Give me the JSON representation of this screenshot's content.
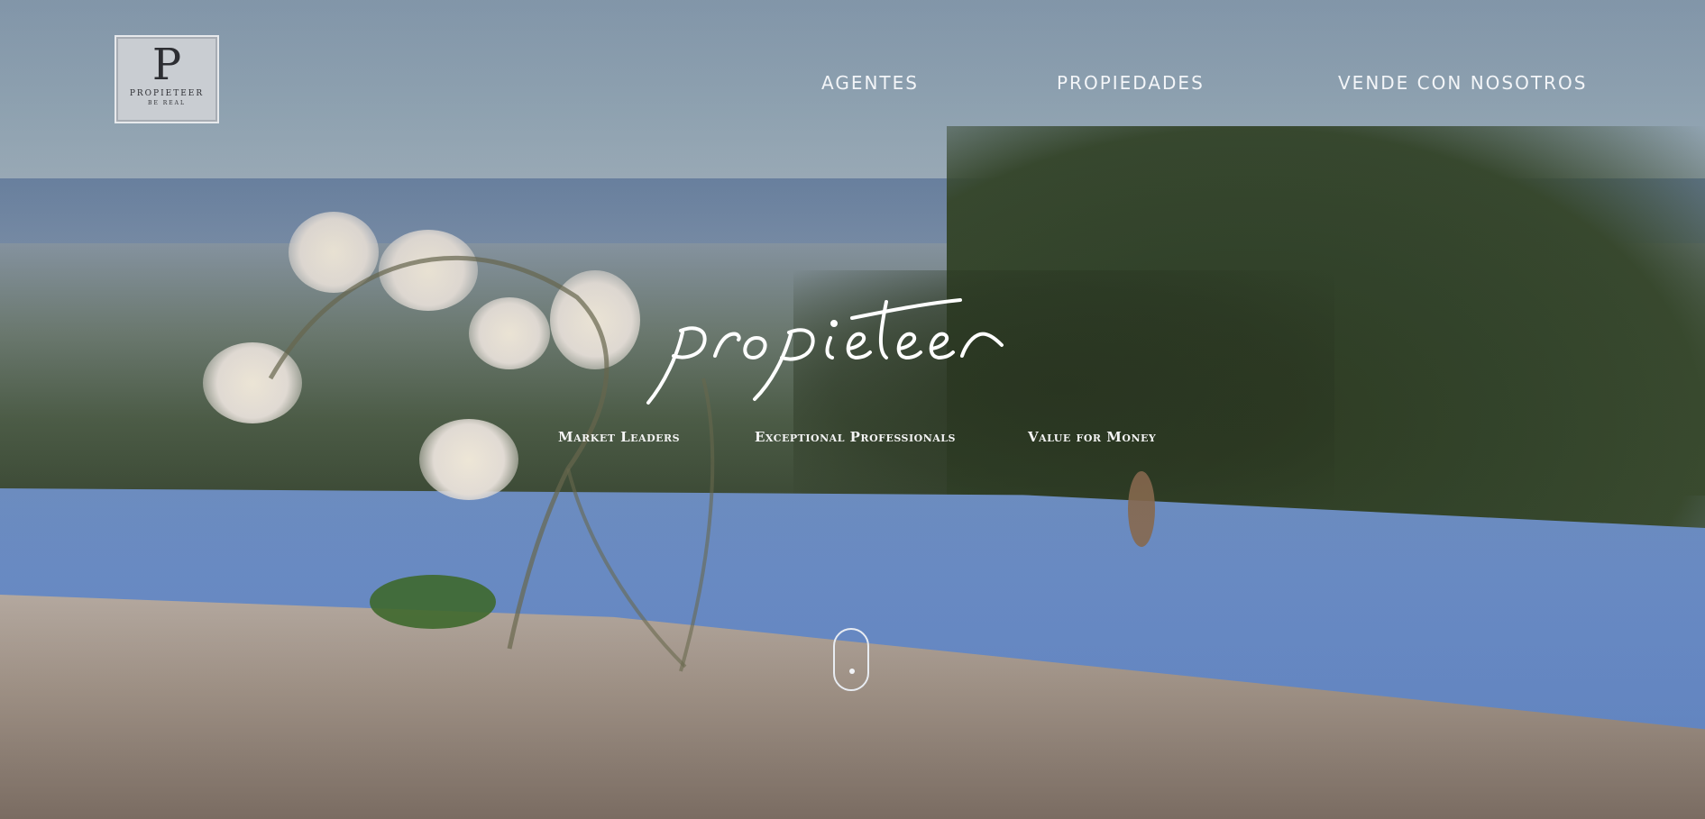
{
  "header": {
    "logo": {
      "letter": "P",
      "name": "PROPIETEER",
      "tagline": "BE REAL"
    },
    "nav": [
      {
        "label": "AGENTES"
      },
      {
        "label": "PROPIEDADES"
      },
      {
        "label": "VENDE CON NOSOTROS"
      }
    ]
  },
  "hero": {
    "wordmark": "propieteer",
    "taglines": [
      "Market Leaders",
      "Exceptional Professionals",
      "Value for Money"
    ],
    "scroll_indicator": "mouse-scroll-icon"
  },
  "colors": {
    "nav_text": "#f3f5f8",
    "wordmark": "#ffffff",
    "logo_bg": "#c9cdd2",
    "logo_ink": "#2d2e33"
  }
}
